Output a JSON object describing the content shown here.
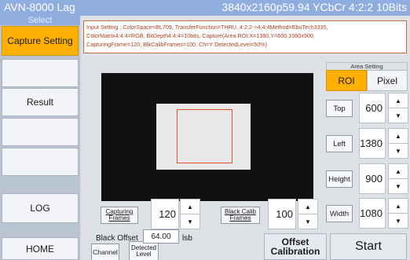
{
  "app": {
    "title": "AVN-8000  Lag",
    "format": "3840x2160p59.94  YCbCr 4:2:2 10Bits"
  },
  "sidebar": {
    "header": "Select",
    "items": [
      {
        "label": "Capture Setting",
        "active": true
      },
      {
        "label": ""
      },
      {
        "label": "Result"
      },
      {
        "label": ""
      },
      {
        "label": ""
      },
      {
        "label": "LOG"
      },
      {
        "label": "HOME"
      }
    ]
  },
  "input_setting": {
    "line1": "Input Setting :  ColorSpace=Bt.709, TransferFunction=THRU, 4:2:2->4:4:4Method=EbuTech3335,",
    "line2": "ColorMatrix4:4:4=RGB, BitDepth4:4:4=10bits, Capture(Area ROI:X=1380,Y=600,1080x900,",
    "line3": "CapturingFrame=120, BlkCalibFrames=100, Ch=Y DetectedLevel=50%)"
  },
  "area_setting": {
    "label": "Area Setting",
    "roi": "ROI",
    "pixel": "Pixel",
    "selected": "ROI"
  },
  "params": {
    "top": {
      "label": "Top",
      "value": "600"
    },
    "left": {
      "label": "Left",
      "value": "1380"
    },
    "height": {
      "label": "Height",
      "value": "900"
    },
    "width": {
      "label": "Width",
      "value": "1080"
    }
  },
  "capture": {
    "capturing_frames_label": "Capturing Frames",
    "capturing_frames_value": "120",
    "black_calib_label": "Black Calib Frames",
    "black_calib_value": "100"
  },
  "bottom": {
    "channel": "Channel",
    "detected_level": "Detected Level",
    "black_offset_label": "Black Offset",
    "black_offset_value": "64.00",
    "unit": "lsb",
    "offset_calibration": "Offset Calibration",
    "start": "Start"
  },
  "icons": {
    "up": "▲",
    "down": "▼"
  },
  "colors": {
    "accent": "#ffb000",
    "title_bar": "#8faedf",
    "roi_border": "#e0522a"
  }
}
